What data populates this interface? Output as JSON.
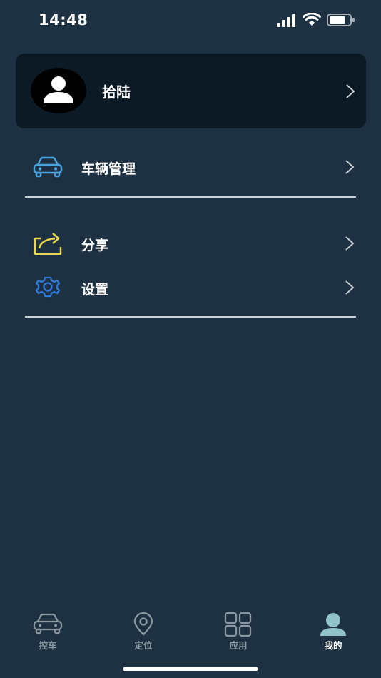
{
  "status_bar": {
    "time": "14:48"
  },
  "profile": {
    "name": "拾陆"
  },
  "menu": {
    "vehicle_management": "车辆管理",
    "share": "分享",
    "settings": "设置"
  },
  "tabs": [
    {
      "label": "控车",
      "icon": "car-icon",
      "active": false
    },
    {
      "label": "定位",
      "icon": "location-pin-icon",
      "active": false
    },
    {
      "label": "应用",
      "icon": "apps-grid-icon",
      "active": false
    },
    {
      "label": "我的",
      "icon": "profile-icon",
      "active": true
    }
  ],
  "colors": {
    "background": "#1e3142",
    "card": "#0b1a24",
    "vehicle_icon": "#4aa3df",
    "share_icon": "#e8d84a",
    "settings_icon": "#2f7be0",
    "active_tab_icon": "#8fc3c8",
    "inactive_tab": "#8a96a0"
  }
}
